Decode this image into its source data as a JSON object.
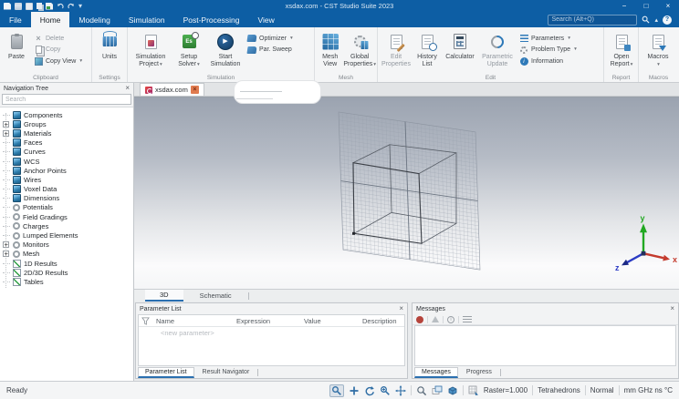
{
  "titlebar": {
    "title": "xsdax.com - CST Studio Suite 2023",
    "search_placeholder": "Search (Alt+Q)"
  },
  "icons": {
    "minimize": "−",
    "maximize": "□",
    "close": "×",
    "caret_down": "▾",
    "caret_up": "▴",
    "play": "▶",
    "help": "?",
    "info_i": "i",
    "solver_badge": "Es"
  },
  "menu_tabs": [
    {
      "label": "File"
    },
    {
      "label": "Home"
    },
    {
      "label": "Modeling"
    },
    {
      "label": "Simulation"
    },
    {
      "label": "Post-Processing"
    },
    {
      "label": "View"
    }
  ],
  "ribbon": {
    "clipboard": {
      "group": "Clipboard",
      "paste": "Paste",
      "delete": "Delete",
      "copy": "Copy",
      "copy_view": "Copy View"
    },
    "settings": {
      "group": "Settings",
      "units": "Units"
    },
    "simulation": {
      "group": "Simulation",
      "project_1": "Simulation",
      "project_2": "Project",
      "solver_1": "Setup",
      "solver_2": "Solver",
      "start_1": "Start",
      "start_2": "Simulation",
      "optimizer": "Optimizer",
      "par_sweep": "Par. Sweep"
    },
    "mesh": {
      "group": "Mesh",
      "mesh_view_1": "Mesh",
      "mesh_view_2": "View",
      "global_1": "Global",
      "global_2": "Properties"
    },
    "edit": {
      "group": "Edit",
      "props_1": "Edit",
      "props_2": "Properties",
      "history_1": "History",
      "history_2": "List",
      "calculator": "Calculator",
      "update_1": "Parametric",
      "update_2": "Update",
      "parameters": "Parameters",
      "problem_type": "Problem Type",
      "information": "Information"
    },
    "report": {
      "group": "Report",
      "open_1": "Open",
      "open_2": "Report"
    },
    "macros": {
      "group": "Macros",
      "label": "Macros"
    }
  },
  "nav_tree": {
    "title": "Navigation Tree",
    "search_placeholder": "Search",
    "items": [
      {
        "label": "Components"
      },
      {
        "label": "Groups"
      },
      {
        "label": "Materials"
      },
      {
        "label": "Faces"
      },
      {
        "label": "Curves"
      },
      {
        "label": "WCS"
      },
      {
        "label": "Anchor Points"
      },
      {
        "label": "Wires"
      },
      {
        "label": "Voxel Data"
      },
      {
        "label": "Dimensions"
      },
      {
        "label": "Potentials"
      },
      {
        "label": "Field Gradings"
      },
      {
        "label": "Charges"
      },
      {
        "label": "Lumped Elements"
      },
      {
        "label": "Monitors"
      },
      {
        "label": "Mesh"
      },
      {
        "label": "1D Results"
      },
      {
        "label": "2D/3D Results"
      },
      {
        "label": "Tables"
      }
    ]
  },
  "document": {
    "tab": "xsdax.com"
  },
  "view_tabs": {
    "t3d": "3D",
    "schematic": "Schematic"
  },
  "axes": {
    "x": "x",
    "y": "y",
    "z": "z"
  },
  "parameter_list": {
    "title": "Parameter List",
    "columns": {
      "name": "Name",
      "expression": "Expression",
      "value": "Value",
      "description": "Description"
    },
    "new_parameter": "<new parameter>",
    "tab_parameter_list": "Parameter List",
    "tab_result_navigator": "Result Navigator"
  },
  "messages": {
    "title": "Messages",
    "tab_messages": "Messages",
    "tab_progress": "Progress"
  },
  "statusbar": {
    "ready": "Ready",
    "raster": "Raster=1.000",
    "mesh_type": "Tetrahedrons",
    "mode": "Normal",
    "units": "mm GHz ns °C"
  }
}
